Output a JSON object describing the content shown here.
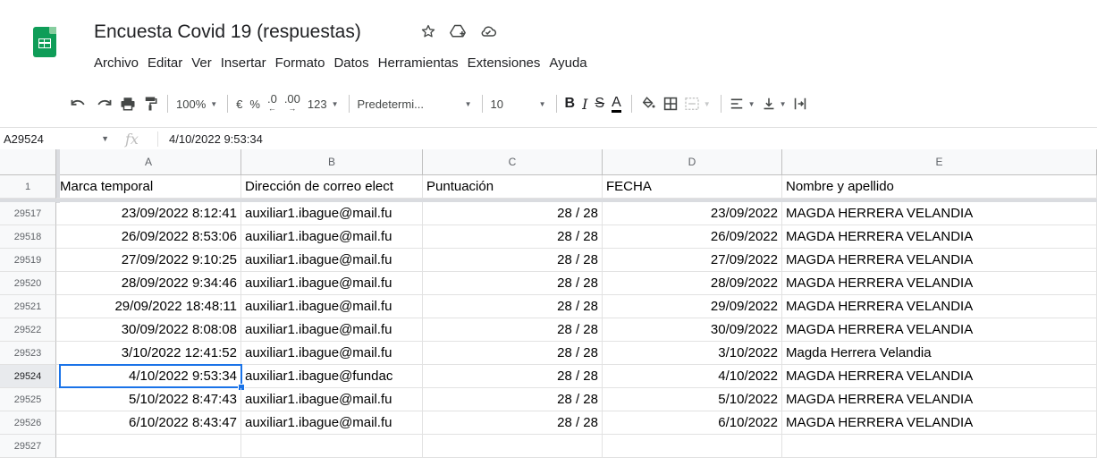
{
  "doc": {
    "title": "Encuesta Covid 19  (respuestas)",
    "icons": [
      "star-icon",
      "move-to-drive-icon",
      "cloud-status-icon"
    ]
  },
  "menu": [
    "Archivo",
    "Editar",
    "Ver",
    "Insertar",
    "Formato",
    "Datos",
    "Herramientas",
    "Extensiones",
    "Ayuda"
  ],
  "toolbar": {
    "zoom": "100%",
    "currency": "€",
    "percent": "%",
    "dec_decrease": ".0",
    "dec_increase": ".00",
    "number_format": "123",
    "font": "Predetermi...",
    "font_size": "10",
    "bold": "B",
    "italic": "I",
    "strike": "S",
    "text_color": "A"
  },
  "formula_bar": {
    "name_box": "A29524",
    "fx": "fx",
    "value": "4/10/2022 9:53:34"
  },
  "columns": [
    "A",
    "B",
    "C",
    "D",
    "E"
  ],
  "header_row": {
    "num": "1",
    "cells": [
      "Marca temporal",
      "Dirección de correo elect",
      "Puntuación",
      "FECHA",
      "Nombre y apellido"
    ]
  },
  "rows": [
    {
      "num": "29517",
      "a": "23/09/2022 8:12:41",
      "b": "auxiliar1.ibague@mail.fu",
      "c": "28 / 28",
      "d": "23/09/2022",
      "e": "MAGDA HERRERA VELANDIA"
    },
    {
      "num": "29518",
      "a": "26/09/2022 8:53:06",
      "b": "auxiliar1.ibague@mail.fu",
      "c": "28 / 28",
      "d": "26/09/2022",
      "e": "MAGDA HERRERA VELANDIA"
    },
    {
      "num": "29519",
      "a": "27/09/2022 9:10:25",
      "b": "auxiliar1.ibague@mail.fu",
      "c": "28 / 28",
      "d": "27/09/2022",
      "e": "MAGDA HERRERA VELANDIA"
    },
    {
      "num": "29520",
      "a": "28/09/2022 9:34:46",
      "b": "auxiliar1.ibague@mail.fu",
      "c": "28 / 28",
      "d": "28/09/2022",
      "e": "MAGDA HERRERA VELANDIA"
    },
    {
      "num": "29521",
      "a": "29/09/2022 18:48:11",
      "b": "auxiliar1.ibague@mail.fu",
      "c": "28 / 28",
      "d": "29/09/2022",
      "e": "MAGDA HERRERA VELANDIA"
    },
    {
      "num": "29522",
      "a": "30/09/2022 8:08:08",
      "b": "auxiliar1.ibague@mail.fu",
      "c": "28 / 28",
      "d": "30/09/2022",
      "e": "MAGDA HERRERA VELANDIA"
    },
    {
      "num": "29523",
      "a": "3/10/2022 12:41:52",
      "b": "auxiliar1.ibague@mail.fu",
      "c": "28 / 28",
      "d": "3/10/2022",
      "e": "Magda Herrera Velandia"
    },
    {
      "num": "29524",
      "a": "4/10/2022 9:53:34",
      "b": "auxiliar1.ibague@fundac",
      "c": "28 / 28",
      "d": "4/10/2022",
      "e": "MAGDA HERRERA VELANDIA"
    },
    {
      "num": "29525",
      "a": "5/10/2022 8:47:43",
      "b": "auxiliar1.ibague@mail.fu",
      "c": "28 / 28",
      "d": "5/10/2022",
      "e": "MAGDA HERRERA VELANDIA"
    },
    {
      "num": "29526",
      "a": "6/10/2022 8:43:47",
      "b": "auxiliar1.ibague@mail.fu",
      "c": "28 / 28",
      "d": "6/10/2022",
      "e": "MAGDA HERRERA VELANDIA"
    },
    {
      "num": "29527",
      "a": "",
      "b": "",
      "c": "",
      "d": "",
      "e": ""
    }
  ],
  "selected_row": "29524",
  "colors": {
    "selection": "#1a73e8",
    "sheets_green": "#0f9d58"
  }
}
